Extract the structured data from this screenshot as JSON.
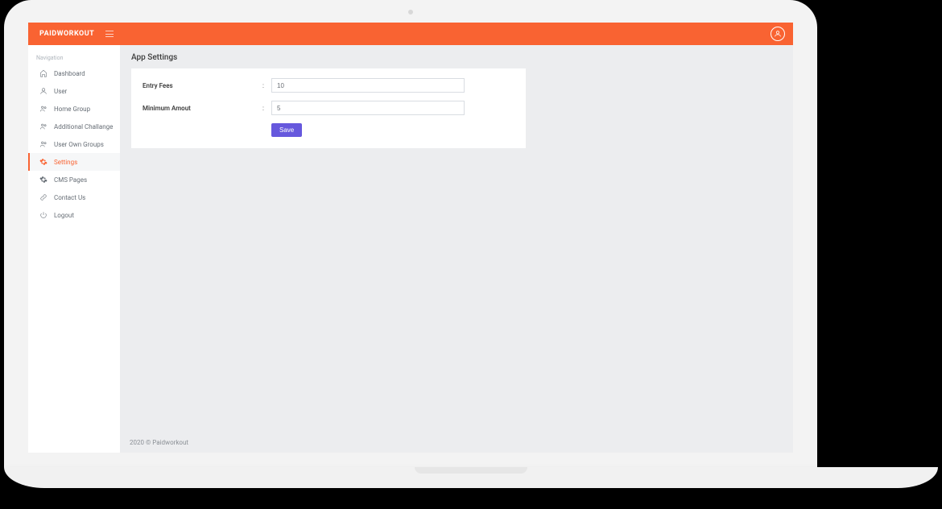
{
  "header": {
    "brand": "PAIDWORKOUT"
  },
  "sidebar": {
    "section_title": "Navigation",
    "items": [
      {
        "label": "Dashboard"
      },
      {
        "label": "User"
      },
      {
        "label": "Home Group"
      },
      {
        "label": "Additional Challange"
      },
      {
        "label": "User Own Groups"
      },
      {
        "label": "Settings"
      },
      {
        "label": "CMS Pages"
      },
      {
        "label": "Contact Us"
      },
      {
        "label": "Logout"
      }
    ]
  },
  "page": {
    "title": "App Settings",
    "form": {
      "entry_fees_label": "Entry Fees",
      "entry_fees_value": "10",
      "minimum_amount_label": "Minimum Amout",
      "minimum_amount_value": "5",
      "save_label": "Save"
    }
  },
  "footer": {
    "text": "2020 © Paidworkout"
  }
}
